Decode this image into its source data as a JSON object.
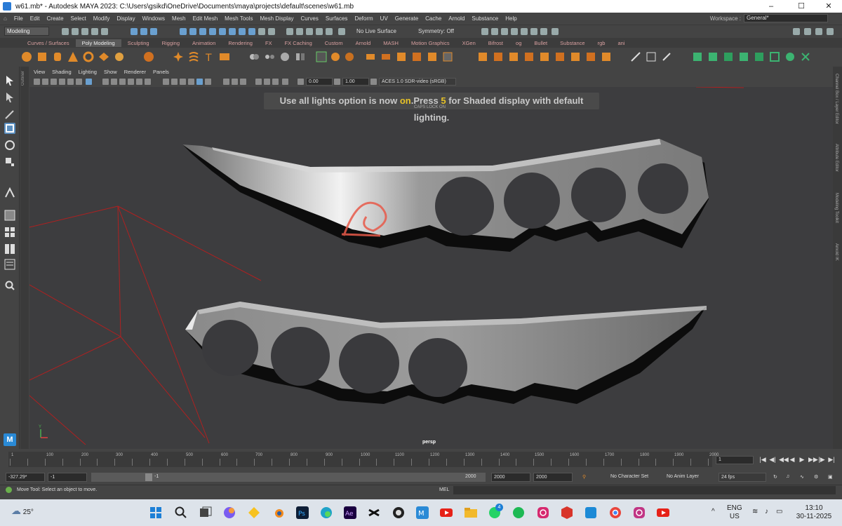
{
  "window": {
    "title": "w61.mb* - Autodesk MAYA 2023: C:\\Users\\gsikd\\OneDrive\\Documents\\maya\\projects\\default\\scenes\\w61.mb",
    "controls": [
      "–",
      "☐",
      "✕"
    ]
  },
  "menubar": {
    "items": [
      "File",
      "Edit",
      "Create",
      "Select",
      "Modify",
      "Display",
      "Windows",
      "Mesh",
      "Edit Mesh",
      "Mesh Tools",
      "Mesh Display",
      "Curves",
      "Surfaces",
      "Deform",
      "UV",
      "Generate",
      "Cache",
      "Arnold",
      "Substance",
      "Help"
    ],
    "workspace_label": "Workspace :",
    "workspace_value": "General*"
  },
  "statusline": {
    "mode": "Modeling",
    "live_surface": "No Live Surface",
    "symmetry": "Symmetry: Off"
  },
  "shelf_tabs": {
    "items": [
      "Curves / Surfaces",
      "Poly Modeling",
      "Sculpting",
      "Rigging",
      "Animation",
      "Rendering",
      "FX",
      "FX Caching",
      "Custom",
      "Arnold",
      "MASH",
      "Motion Graphics",
      "XGen",
      "Bifrost",
      "og",
      "Bullet",
      "Substance",
      "rgb",
      "ani"
    ],
    "active": "Poly Modeling"
  },
  "panel": {
    "menu": [
      "View",
      "Shading",
      "Lighting",
      "Show",
      "Renderer",
      "Panels"
    ],
    "exposure": "0.00",
    "gamma": "1.00",
    "colorspace": "ACES 1.0 SDR-video (sRGB)"
  },
  "viewport": {
    "hud_message_pre": "Use all lights option is now ",
    "hud_message_on": "on",
    "hud_message_mid": ".Press ",
    "hud_message_key": "5",
    "hud_message_post": " for Shaded display with default lighting.",
    "caps_lock": "CAPS LOCK ON",
    "camera": "persp",
    "maya_logo": "M",
    "axis_label": "Y"
  },
  "side_panels": {
    "left": "Outliner",
    "right": [
      "Channel Box / Layer Editor",
      "Attribute Editor",
      "Modeling Toolkit",
      "Arnold IK"
    ]
  },
  "timeline": {
    "ticks": [
      "1",
      "50",
      "100",
      "150",
      "200",
      "250",
      "300",
      "350",
      "400",
      "450",
      "500",
      "550",
      "600",
      "650",
      "700",
      "750",
      "800",
      "850",
      "900",
      "950",
      "1000",
      "1050",
      "1100",
      "1150",
      "1200",
      "1250",
      "1300",
      "1350",
      "1400",
      "1450",
      "1500",
      "1550",
      "1600",
      "1650",
      "1700",
      "1750",
      "1800",
      "1850",
      "1900",
      "1950",
      "2000"
    ],
    "current_frame": "1",
    "playback_buttons": [
      "|◀",
      "◀|",
      "◀◀",
      "◀",
      "▶",
      "▶▶",
      "|▶",
      "▶|"
    ]
  },
  "range": {
    "field_a": "-327.29*",
    "field_b": "-1",
    "slider_start": "-1",
    "slider_end": "2000",
    "end_a": "2000",
    "end_b": "2000",
    "character_set": "No Character Set",
    "anim_layer": "No Anim Layer",
    "fps": "24 fps"
  },
  "cmdline": {
    "help_text": "Move Tool: Select an object to move.",
    "mel_label": "MEL"
  },
  "taskbar": {
    "temperature": "25°",
    "badge_whatsapp": "4",
    "lang_top": "ENG",
    "lang_bottom": "US",
    "time": "13:10",
    "date": "30-11-2025"
  },
  "colors": {
    "maya_accent": "#2a8ad6",
    "hud_highlight": "#e7c227",
    "grid_red": "#c02020"
  }
}
